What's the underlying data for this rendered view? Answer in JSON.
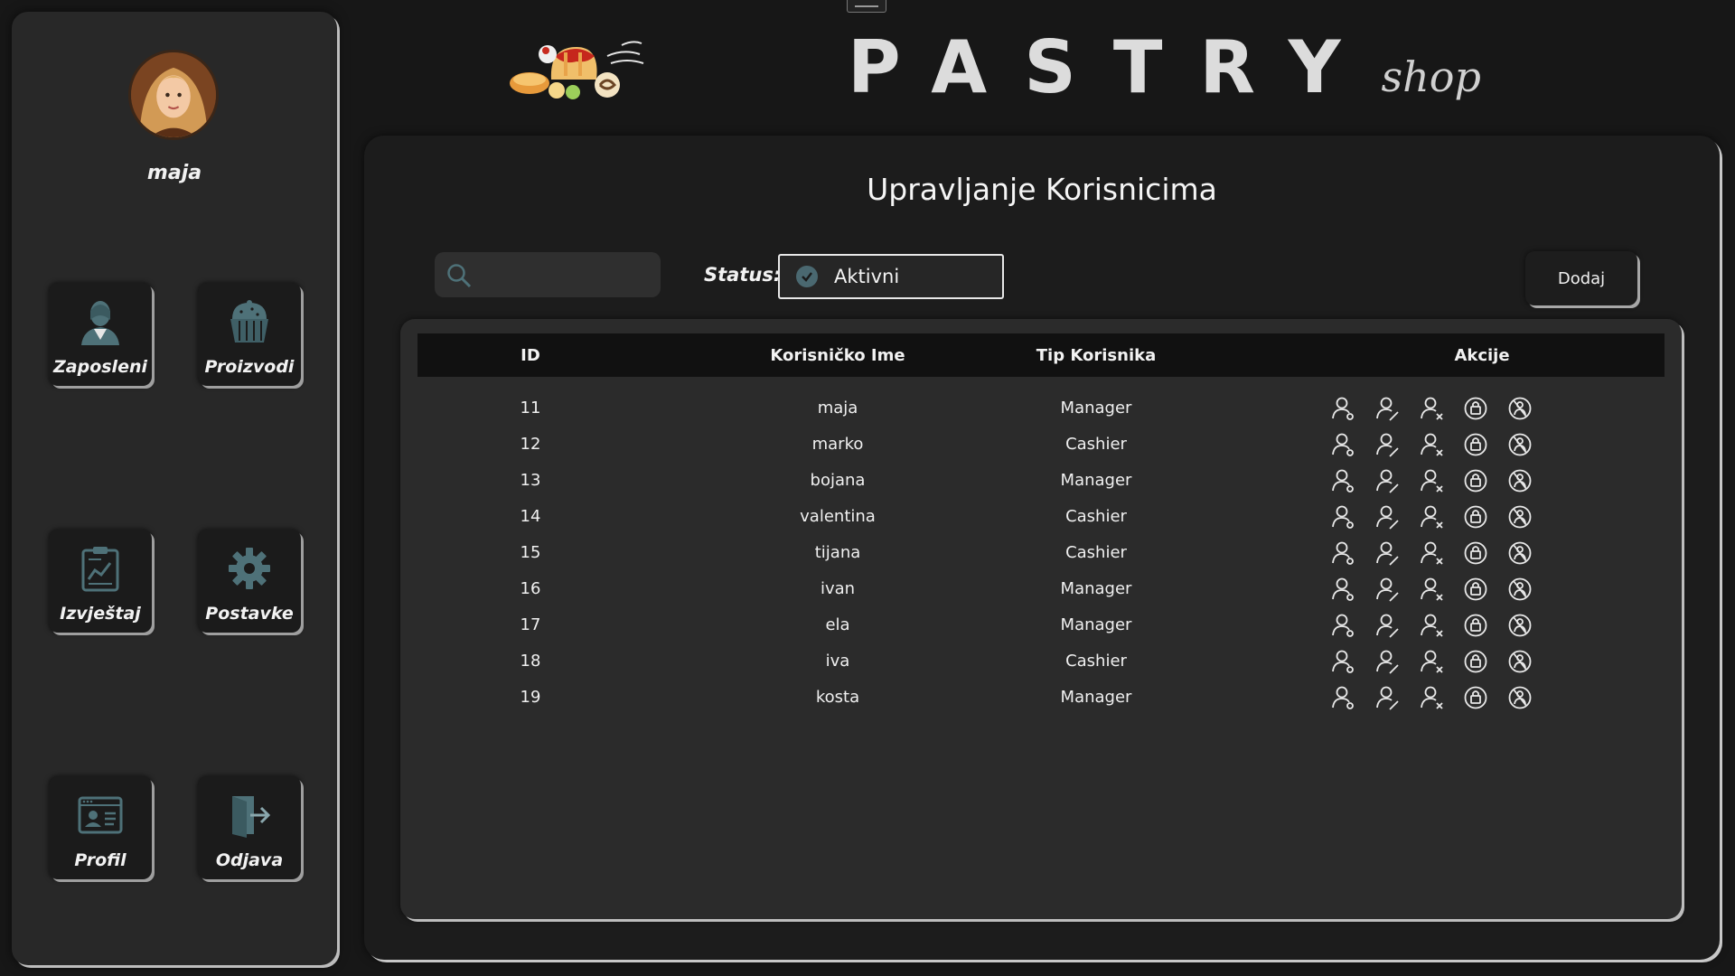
{
  "app": {
    "brand_main": "PASTRY",
    "brand_sub": "shop"
  },
  "sidebar": {
    "username": "maja",
    "items": [
      {
        "label": "Zaposleni",
        "icon": "employee-icon"
      },
      {
        "label": "Proizvodi",
        "icon": "cupcake-icon"
      },
      {
        "label": "Izvještaj",
        "icon": "report-icon"
      },
      {
        "label": "Postavke",
        "icon": "gear-icon"
      },
      {
        "label": "Profil",
        "icon": "profile-card-icon"
      },
      {
        "label": "Odjava",
        "icon": "logout-icon"
      }
    ]
  },
  "main": {
    "title": "Upravljanje Korisnicima",
    "search": {
      "value": "",
      "placeholder": ""
    },
    "status_label": "Status:",
    "status_value": "Aktivni",
    "add_button": "Dodaj",
    "columns": [
      "ID",
      "Korisničko Ime",
      "Tip Korisnika",
      "Akcije"
    ],
    "rows": [
      {
        "id": "11",
        "name": "maja",
        "type": "Manager"
      },
      {
        "id": "12",
        "name": "marko",
        "type": "Cashier"
      },
      {
        "id": "13",
        "name": "bojana",
        "type": "Manager"
      },
      {
        "id": "14",
        "name": "valentina",
        "type": "Cashier"
      },
      {
        "id": "15",
        "name": "tijana",
        "type": "Cashier"
      },
      {
        "id": "16",
        "name": "ivan",
        "type": "Manager"
      },
      {
        "id": "17",
        "name": "ela",
        "type": "Manager"
      },
      {
        "id": "18",
        "name": "iva",
        "type": "Cashier"
      },
      {
        "id": "19",
        "name": "kosta",
        "type": "Manager"
      }
    ],
    "row_actions": [
      "view-user-icon",
      "edit-user-icon",
      "delete-user-icon",
      "lock-user-icon",
      "reset-password-icon"
    ]
  },
  "colors": {
    "background": "#171717",
    "sidebar": "#282828",
    "panel": "#1c1c1c",
    "table_card": "#2b2b2b",
    "table_header": "#111111",
    "accent_icon": "#4a6870"
  }
}
